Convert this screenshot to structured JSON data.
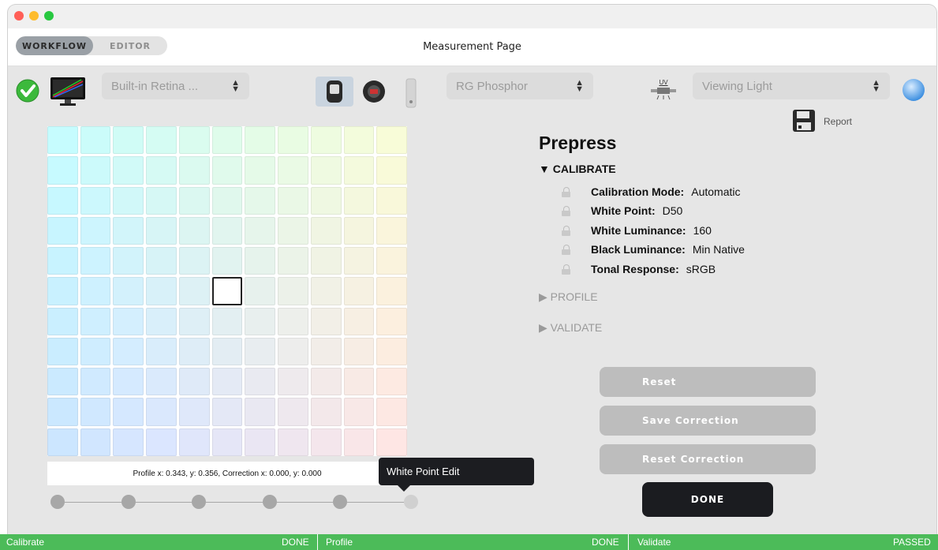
{
  "window": {
    "title": "Measurement Page"
  },
  "mode_tabs": [
    {
      "label": "WORKFLOW",
      "selected": true
    },
    {
      "label": "EDITOR",
      "selected": false
    }
  ],
  "toolbar": {
    "display_select": "Built-in Retina ...",
    "phosphor_select": "RG Phosphor",
    "light_select": "Viewing Light",
    "uv_label": "UV",
    "report_label": "Report"
  },
  "patch_grid": {
    "rows": 11,
    "cols": 11,
    "selected_row": 5,
    "selected_col": 5,
    "readout": "Profile x: 0.343, y: 0.356, Correction x: 0.000, y: 0.000"
  },
  "steps": {
    "count": 6,
    "active": 5
  },
  "tooltip": {
    "text": "White Point Edit"
  },
  "panel": {
    "title": "Prepress",
    "calibrate_label": "▼ CALIBRATE",
    "settings": [
      {
        "key": "Calibration Mode:",
        "value": "Automatic"
      },
      {
        "key": "White Point:",
        "value": "D50"
      },
      {
        "key": "White Luminance:",
        "value": "160"
      },
      {
        "key": "Black Luminance:",
        "value": "Min Native"
      },
      {
        "key": "Tonal Response:",
        "value": "sRGB"
      }
    ],
    "profile_label": "▶ PROFILE",
    "validate_label": "▶ VALIDATE"
  },
  "buttons": {
    "reset": "Reset",
    "save_correction": "Save Correction",
    "reset_correction": "Reset Correction",
    "done": "DONE"
  },
  "status_bar": [
    {
      "label": "Calibrate",
      "status": "DONE"
    },
    {
      "label": "Profile",
      "status": "DONE"
    },
    {
      "label": "Validate",
      "status": "PASSED"
    }
  ],
  "colors": {
    "status_green": "#4cbb59",
    "traffic_red": "#ff5f57",
    "traffic_yellow": "#febc2e",
    "traffic_green": "#28c840",
    "check_green": "#3cb93c",
    "dark_button": "#1b1c20"
  }
}
